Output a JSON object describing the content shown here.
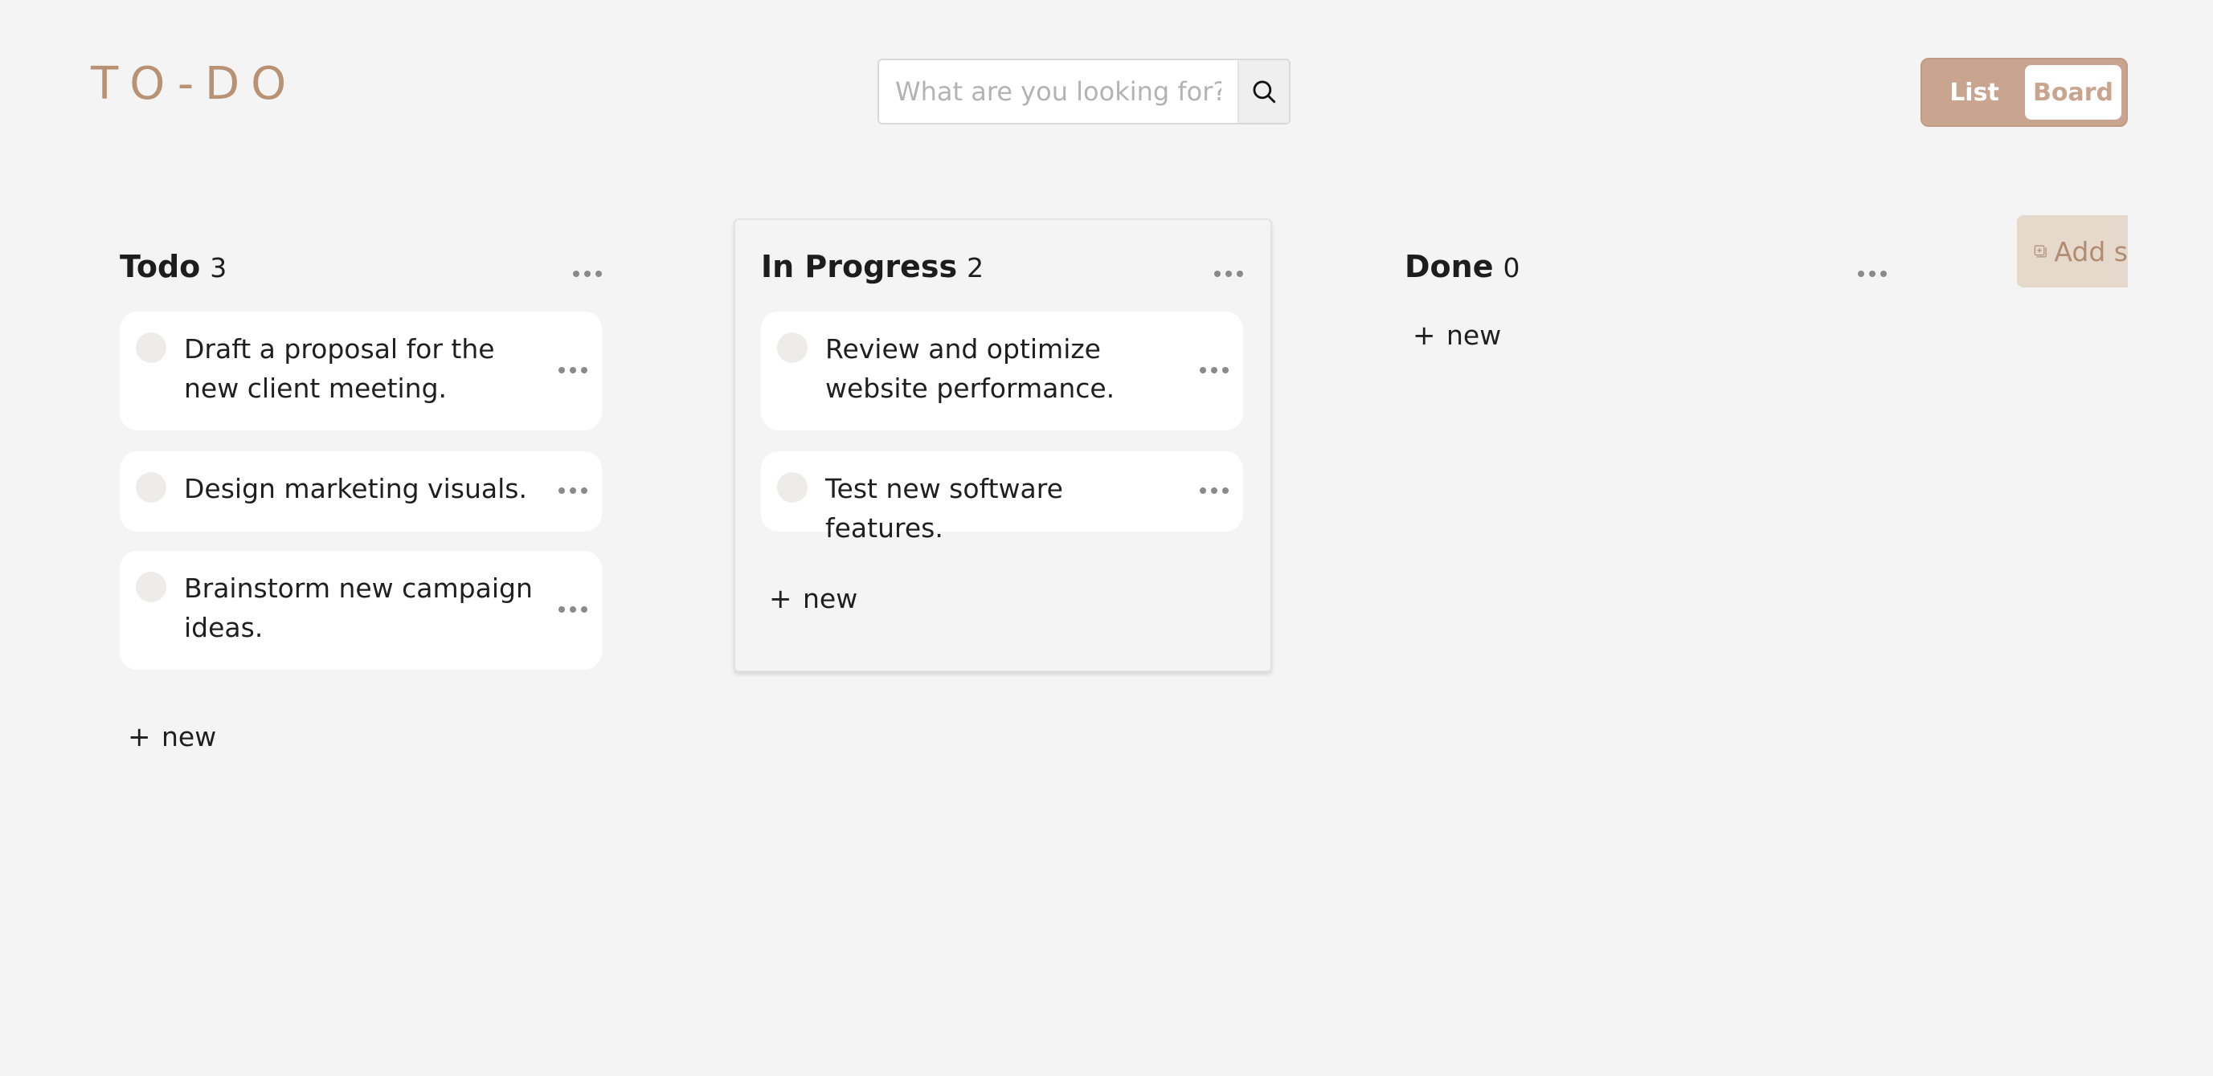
{
  "app": {
    "title": "TO-DO"
  },
  "search": {
    "placeholder": "What are you looking for?",
    "icon": "search-icon"
  },
  "view_toggle": {
    "list_label": "List",
    "board_label": "Board",
    "active": "Board"
  },
  "add_section": {
    "label": "Add s",
    "icon": "add-square-icon"
  },
  "colors": {
    "background": "#f4f4f4",
    "accent": "#b99173",
    "toggle_bg": "#c9a590",
    "add_section_bg": "#e6d9cc"
  },
  "columns": [
    {
      "title": "Todo",
      "count": "3",
      "new_label": "new",
      "cards": [
        {
          "text": "Draft a proposal for the new client meeting."
        },
        {
          "text": "Design marketing visuals."
        },
        {
          "text": "Brainstorm new campaign ideas."
        }
      ]
    },
    {
      "title": "In Progress",
      "count": "2",
      "new_label": "new",
      "cards": [
        {
          "text": "Review and optimize website performance."
        },
        {
          "text": "Test new software features."
        }
      ]
    },
    {
      "title": "Done",
      "count": "0",
      "new_label": "new",
      "cards": []
    }
  ]
}
